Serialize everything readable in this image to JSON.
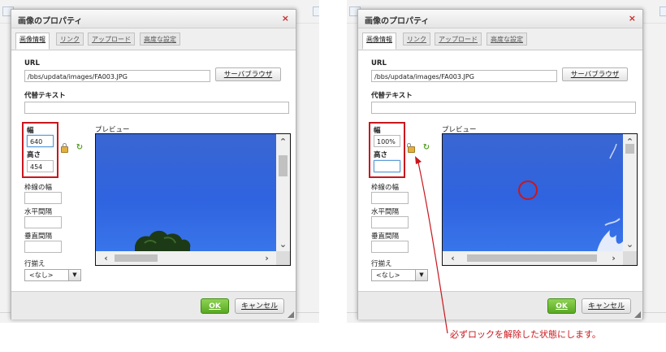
{
  "dialog": {
    "title": "画像のプロパティ",
    "close_glyph": "×",
    "tabs": [
      "画像情報",
      "リンク",
      "アップロード",
      "高度な設定"
    ],
    "url_label": "URL",
    "url_value": "/bbs/updata/images/FA003.JPG",
    "browse_button": "サーバブラウザ",
    "alt_label": "代替テキスト",
    "alt_value": "",
    "width_label": "幅",
    "height_label": "高さ",
    "preview_label": "プレビュー",
    "border_label": "枠線の幅",
    "hspace_label": "水平間隔",
    "vspace_label": "垂直間隔",
    "align_label": "行揃え",
    "align_value": "<なし>",
    "ok_button": "OK",
    "cancel_button": "キャンセル"
  },
  "left_state": {
    "width_value": "640",
    "height_value": "454",
    "lock": "locked-icon"
  },
  "right_state": {
    "width_value": "100%",
    "height_value": "",
    "lock": "unlocked-icon"
  },
  "annotation": {
    "note": "必ずロックを解除した状態にします。"
  },
  "colors": {
    "highlight": "#c8171d",
    "ok_green": "#5aa823",
    "sky_blue": "#2f63df",
    "close_red": "#cc2929"
  }
}
